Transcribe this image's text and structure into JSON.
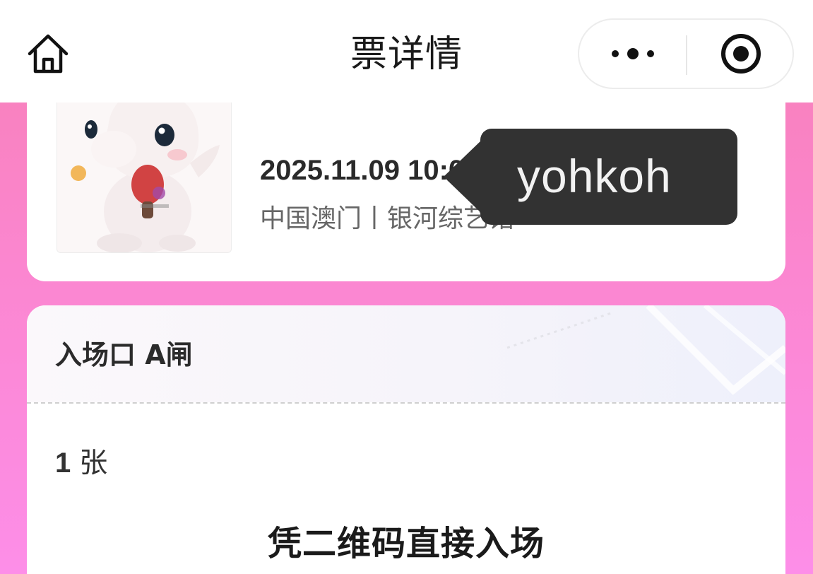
{
  "navbar": {
    "title": "票详情",
    "home_icon": "home-icon",
    "more_icon": "more-dots-icon",
    "close_icon": "target-circle-icon"
  },
  "event": {
    "datetime": "2025.11.09 10:00",
    "venue": "中国澳门丨银河综艺馆",
    "poster_icon": "mascot-poster"
  },
  "tooltip": {
    "text": "yohkoh"
  },
  "ticket": {
    "gate": "入场口 A闸",
    "count": "1",
    "count_unit": "张",
    "entry_note": "凭二维码直接入场"
  },
  "colors": {
    "background_top": "#f77fb6",
    "background_bottom": "#fd8ee8",
    "tooltip_bg": "#323232",
    "card_bg": "#ffffff"
  }
}
